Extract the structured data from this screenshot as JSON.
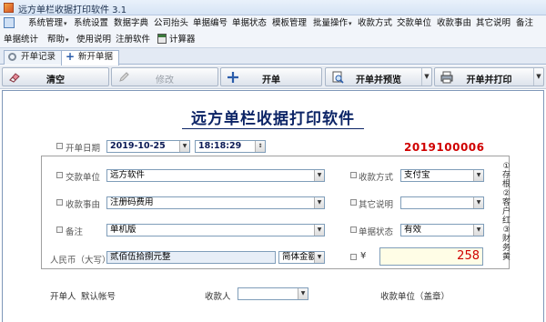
{
  "window": {
    "title": "远方单栏收据打印软件 3.1"
  },
  "menu": {
    "row1": [
      {
        "label": "系统管理",
        "arrow": "▾"
      },
      {
        "label": "系统设置",
        "arrow": ""
      },
      {
        "label": "数据字典",
        "arrow": ""
      },
      {
        "label": "公司抬头",
        "arrow": ""
      },
      {
        "label": "单据编号",
        "arrow": ""
      },
      {
        "label": "单据状态",
        "arrow": ""
      },
      {
        "label": "模板管理",
        "arrow": ""
      },
      {
        "label": "批量操作",
        "arrow": "▾"
      },
      {
        "label": "收款方式",
        "arrow": ""
      },
      {
        "label": "交款单位",
        "arrow": ""
      },
      {
        "label": "收款事由",
        "arrow": ""
      },
      {
        "label": "其它说明",
        "arrow": ""
      },
      {
        "label": "备注",
        "arrow": ""
      }
    ],
    "row2": [
      {
        "label": "单据统计",
        "arrow": ""
      },
      {
        "label": "帮助",
        "arrow": "▾"
      },
      {
        "label": "使用说明",
        "arrow": ""
      },
      {
        "label": "注册软件",
        "arrow": ""
      },
      {
        "label": "计算器",
        "arrow": ""
      }
    ]
  },
  "tabs": [
    {
      "label": "开单记录"
    },
    {
      "label": "新开单据"
    }
  ],
  "toolbar": {
    "clear": "清空",
    "edit": "修改",
    "create": "开单",
    "create_preview": "开单并预览",
    "create_print": "开单并打印"
  },
  "document": {
    "title": "远方单栏收据打印软件",
    "serial_no": "2019100006",
    "date_label": "开单日期",
    "date_value": "2019-10-25",
    "time_value": "18:18:29",
    "payer_label": "交款单位",
    "payer_value": "远方软件",
    "reason_label": "收款事由",
    "reason_value": "注册码费用",
    "remark_label": "备注",
    "remark_value": "单机版",
    "amount_words_label": "人民币（大写）",
    "amount_words_value": "贰佰伍拾捌元整",
    "currency_format": "简体金额",
    "pay_method_label": "收款方式",
    "pay_method_value": "支付宝",
    "other_label": "其它说明",
    "other_value": "",
    "status_label": "单据状态",
    "status_value": "有效",
    "currency_symbol": "¥",
    "amount_value": "258",
    "side_note": "①存根②客户红③财务黄"
  },
  "footer": {
    "issuer_label": "开单人",
    "issuer_value": "默认帐号",
    "receiver_label": "收款人",
    "receiver_value": "",
    "unit_label": "收款单位（盖章）"
  },
  "colors": {
    "accent": "#0c2466",
    "serial": "#d00000",
    "amount_bg": "#fffde6"
  }
}
